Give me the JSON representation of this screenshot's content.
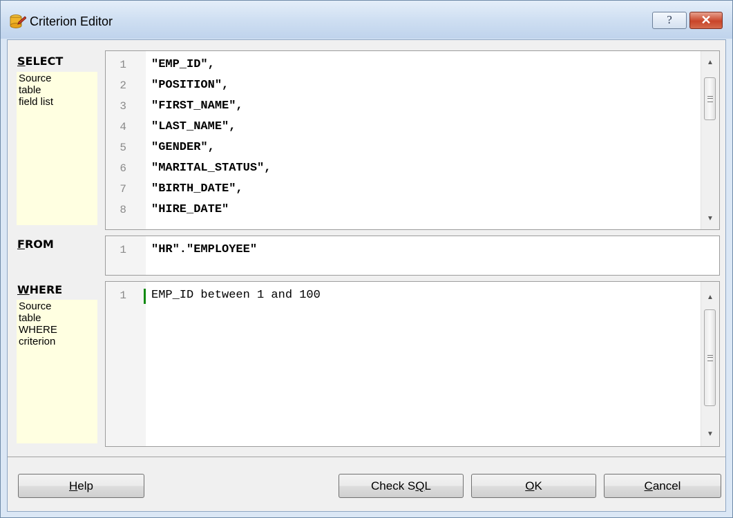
{
  "window": {
    "title": "Criterion Editor",
    "help_glyph": "?",
    "close_glyph": "✕",
    "accent_color": "#128a12"
  },
  "select_section": {
    "label_mnemonic": "S",
    "label_rest": "ELECT",
    "hint": "Source\ntable\nfield list",
    "lines": [
      {
        "num": "1",
        "text": "\"EMP_ID\","
      },
      {
        "num": "2",
        "text": "\"POSITION\","
      },
      {
        "num": "3",
        "text": "\"FIRST_NAME\","
      },
      {
        "num": "4",
        "text": "\"LAST_NAME\","
      },
      {
        "num": "5",
        "text": "\"GENDER\","
      },
      {
        "num": "6",
        "text": "\"MARITAL_STATUS\","
      },
      {
        "num": "7",
        "text": "\"BIRTH_DATE\","
      },
      {
        "num": "8",
        "text": "\"HIRE_DATE\""
      }
    ]
  },
  "from_section": {
    "label_mnemonic": "F",
    "label_rest": "ROM",
    "lines": [
      {
        "num": "1",
        "text": "\"HR\".\"EMPLOYEE\""
      }
    ]
  },
  "where_section": {
    "label_mnemonic": "W",
    "label_rest": "HERE",
    "hint": "Source\ntable\nWHERE\ncriterion",
    "lines": [
      {
        "num": "1",
        "text": "EMP_ID between 1 and 100"
      }
    ]
  },
  "buttons": {
    "help_mnemonic": "H",
    "help_rest": "elp",
    "check_pre": "Check S",
    "check_mnemonic": "Q",
    "check_rest": "L",
    "ok_mnemonic": "O",
    "ok_rest": "K",
    "cancel_mnemonic": "C",
    "cancel_rest": "ancel"
  },
  "icons": {
    "app": "database-edit-icon",
    "scroll_up": "scroll-up-arrow-icon",
    "scroll_down": "scroll-down-arrow-icon"
  }
}
